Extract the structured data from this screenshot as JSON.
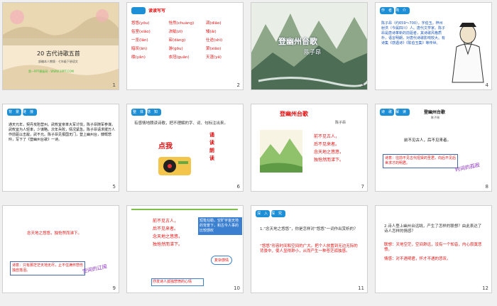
{
  "slides": [
    {
      "num": "1",
      "title": "20 古代诗歌五首",
      "subtitle": "部编本人教版 · 七年级下册语文",
      "footer": "第一PPT模板网 - WWW.1PPT.COM"
    },
    {
      "num": "2",
      "heading": "读读写写",
      "words": [
        [
          "悠悠(yōu)",
          "怆然(chuàng)",
          "凋(diāo)"
        ],
        [
          "俗室(xiāo)",
          "决眦(zì)",
          "矮(ǎi)"
        ],
        [
          "一览(lǎn)",
          "宕(dàng)",
          "仕途(shì)"
        ],
        [
          "暗叹(ān)",
          "游(gōu)",
          "箫(xiāo)"
        ],
        [
          "缕(yǎn)",
          "衣冠(guān)",
          "天涯(yá)"
        ]
      ]
    },
    {
      "num": "3",
      "title": "登幽州台歌",
      "author": "陈子昂"
    },
    {
      "num": "4",
      "tag": "作者简介",
      "text": "陈子昂（约659～700），字伯玉。梓州射洪（今属四川）人。唐代文学家。陈子昂是唐诗革新的前驱者，其诗歌风格质朴，语言明朗，对唐代诗歌影响较大。有诗集《感遇诗》《陈伯玉集》等传世。"
    },
    {
      "num": "5",
      "tag": "背景链接",
      "text": "通天元年，契丹攻陷营州。武攸宜亲率大军讨伐，陈子昂随军参谋。武攸宜为人轻率，少谋略。次年兵败，情况紧急。陈子昂请求拨万人作前驱以击敌，武不允。陈子昂见报国无门，登上幽州台，慷慨悲吟，写下了《登幽州台歌》一诗。"
    },
    {
      "num": "6",
      "tag": "整体感知",
      "text": "有感情地朗读诗歌，把不理解的字、词、句标注出来。",
      "badge": "点我",
      "side": "诵读朗读"
    },
    {
      "num": "7",
      "title": "登幽州台歌",
      "author": "陈子昂",
      "poem": [
        "前不见古人，",
        "后不见来者。",
        "念天地之悠悠，",
        "独怆然而涕下。"
      ]
    },
    {
      "num": "8",
      "tag": "诗歌解读",
      "title": "登幽州台歌",
      "author": "陈子昂",
      "line": "前不见古人，后不见来者。",
      "note": "诗意：往前不见古代招贤的圣君，向后不见后世求才的明君。",
      "tail": "时间的孤寂"
    },
    {
      "num": "9",
      "line": "念天地之悠悠，独怆然而涕下。",
      "note": "诗意：只有那茫茫天地无尽，止不住满怀悲伤独自落泪。",
      "tail": "空间的辽阔"
    },
    {
      "num": "10",
      "poem": [
        "前不见古人，",
        "后不见来者。",
        "念天地之悠悠，",
        "独怆然而涕下。"
      ],
      "box": "短笔勾勒，空旷宇宙天地的背景下，和古今人事的比较感叹",
      "circle": "复杂感情",
      "bottom": "抒发诗人孤独悲愤的心情"
    },
    {
      "num": "11",
      "tag": "深入探究",
      "q": "1.“念天地之悠悠”，你是怎样对“悠悠”一词作出赏析的？",
      "a": "“悠悠”形容时间和空间的广大。把个人放置到无边无际的背景中，使人显得渺小，从而产生一种苍茫孤独感。"
    },
    {
      "num": "12",
      "q": "2.诗人登上幽州台远眺，产生了怎样的联想？由此表达了诗人怎样的情感？",
      "a1": "联想：天地空茫，空间渺远，没有一个知音，内心寂寞悲愤。",
      "a2": "情感：对不遇明君，怀才不遇的悲叹。"
    }
  ]
}
